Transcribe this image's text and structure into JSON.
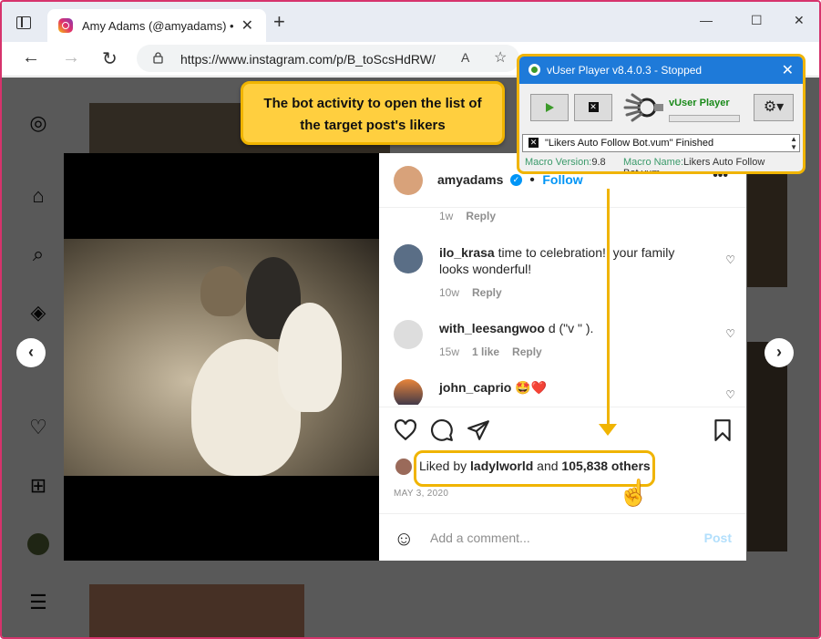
{
  "browser": {
    "tab_title": "Amy Adams (@amyadams) • Inst",
    "url": "https://www.instagram.com/p/B_toScsHdRW/",
    "read_aloud": "A",
    "window_controls": [
      "—",
      "☐",
      "✕"
    ]
  },
  "callout": {
    "line1": "The bot activity to open the list of",
    "line2": "the target post's likers"
  },
  "vuser": {
    "title": "vUser Player v8.4.0.3 - Stopped",
    "brand": "vUser Player",
    "status_text": "\"Likers Auto Follow Bot.vum\" Finished",
    "macro_version_key": "Macro Version:",
    "macro_version_value": "9.8",
    "macro_name_key": "Macro Name:",
    "macro_name_value": "Likers Auto Follow Bot.vum",
    "close_glyph": "✕"
  },
  "post": {
    "username": "amyadams",
    "follow": "Follow",
    "dot": "•",
    "comments": [
      {
        "username": "",
        "text": "",
        "time": "1w",
        "likes": "",
        "reply": "Reply"
      },
      {
        "username": "ilo_krasa",
        "text": "time to celebration!!  your family looks wonderful!",
        "time": "10w",
        "likes": "",
        "reply": "Reply"
      },
      {
        "username": "with_leesangwoo",
        "text": "d (\"v \" ).",
        "time": "15w",
        "likes": "1 like",
        "reply": "Reply"
      },
      {
        "username": "john_caprio",
        "text": "🤩❤️",
        "time": "",
        "likes": "",
        "reply": ""
      }
    ],
    "liked_by_prefix": "Liked by",
    "liked_by_user": "ladylworld",
    "liked_and": "and",
    "liked_others": "105,838 others",
    "date": "MAY 3, 2020",
    "add_comment_placeholder": "Add a comment...",
    "post_button": "Post"
  },
  "colors": {
    "accent_yellow": "#f0b400",
    "instagram_blue": "#0095f6",
    "vuser_blue": "#1e7ad9",
    "frame_border": "#d6336c"
  }
}
